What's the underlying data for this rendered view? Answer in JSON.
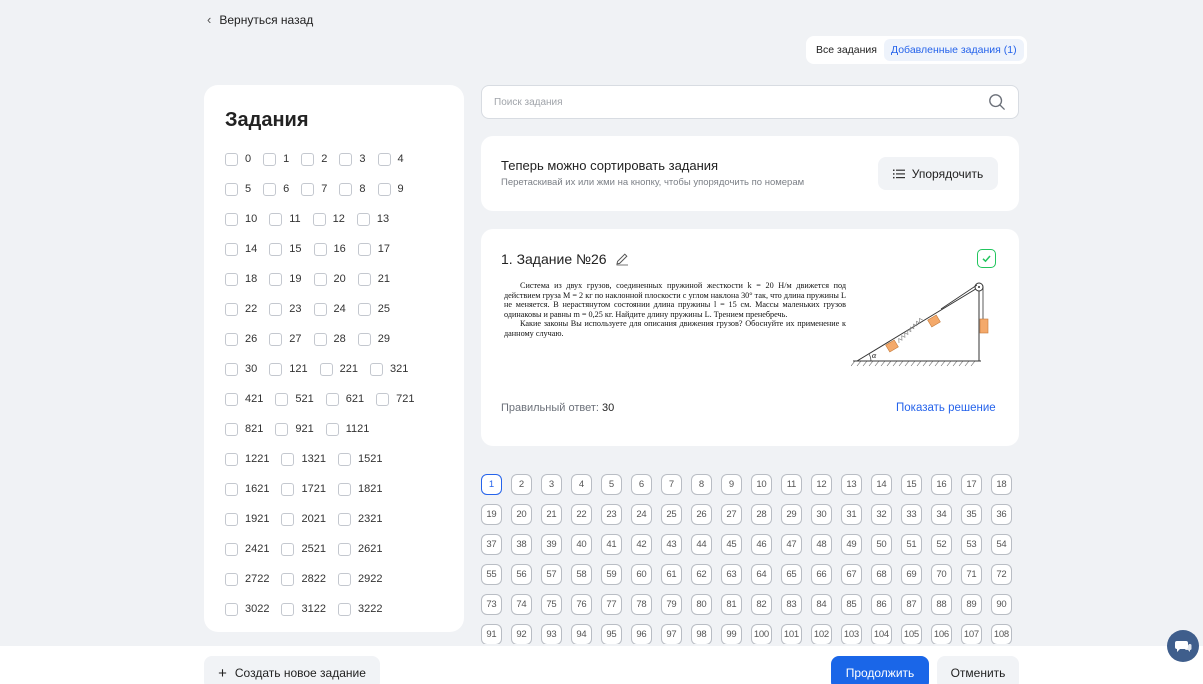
{
  "nav": {
    "back_label": "Вернуться назад"
  },
  "tabs": {
    "all": "Все задания",
    "added": "Добавленные задания (1)"
  },
  "sidebar": {
    "title": "Задания",
    "rows": [
      [
        "0",
        "1",
        "2",
        "3",
        "4"
      ],
      [
        "5",
        "6",
        "7",
        "8",
        "9"
      ],
      [
        "10",
        "11",
        "12",
        "13"
      ],
      [
        "14",
        "15",
        "16",
        "17"
      ],
      [
        "18",
        "19",
        "20",
        "21"
      ],
      [
        "22",
        "23",
        "24",
        "25"
      ],
      [
        "26",
        "27",
        "28",
        "29"
      ],
      [
        "30",
        "121",
        "221",
        "321"
      ],
      [
        "421",
        "521",
        "621",
        "721"
      ],
      [
        "821",
        "921",
        "1121"
      ],
      [
        "1221",
        "1321",
        "1521"
      ],
      [
        "1621",
        "1721",
        "1821"
      ],
      [
        "1921",
        "2021",
        "2321"
      ],
      [
        "2421",
        "2521",
        "2621"
      ],
      [
        "2722",
        "2822",
        "2922"
      ],
      [
        "3022",
        "3122",
        "3222"
      ]
    ]
  },
  "search": {
    "placeholder": "Поиск задания"
  },
  "sort": {
    "title": "Теперь можно сортировать задания",
    "subtitle": "Перетаскивай их или жми на кнопку, чтобы упорядочить по номерам",
    "button_label": "Упорядочить"
  },
  "task": {
    "title": "1. Задание №26",
    "text_p1": "Система из двух грузов, соединенных пружиной жесткости k = 20 Н/м движется под действием груза M = 2 кг по наклонной плоскости с углом наклона 30° так, что длина пружины L не меняется. В нерастянутом состоянии длина пружины l = 15 см. Массы маленьких грузов одинаковы и равны m = 0,25 кг. Найдите длину пружины L. Трением пренебречь.",
    "text_p2": "Какие законы Вы используете для описания движения грузов? Обоснуйте их применение к данному случаю.",
    "figure_label": "α",
    "answer_label": "Правильный ответ:",
    "answer_value": "30",
    "show_solution": "Показать решение",
    "checked": true
  },
  "pager": {
    "active": "1",
    "rows": [
      [
        "1",
        "2",
        "3",
        "4",
        "5",
        "6",
        "7",
        "8",
        "9",
        "10",
        "11",
        "12",
        "13",
        "14",
        "15",
        "16",
        "17",
        "18"
      ],
      [
        "19",
        "20",
        "21",
        "22",
        "23",
        "24",
        "25",
        "26",
        "27",
        "28",
        "29",
        "30",
        "31",
        "32",
        "33",
        "34",
        "35",
        "36"
      ],
      [
        "37",
        "38",
        "39",
        "40",
        "41",
        "42",
        "43",
        "44",
        "45",
        "46",
        "47",
        "48",
        "49",
        "50",
        "51",
        "52",
        "53",
        "54"
      ],
      [
        "55",
        "56",
        "57",
        "58",
        "59",
        "60",
        "61",
        "62",
        "63",
        "64",
        "65",
        "66",
        "67",
        "68",
        "69",
        "70",
        "71",
        "72"
      ],
      [
        "73",
        "74",
        "75",
        "76",
        "77",
        "78",
        "79",
        "80",
        "81",
        "82",
        "83",
        "84",
        "85",
        "86",
        "87",
        "88",
        "89",
        "90"
      ],
      [
        "91",
        "92",
        "93",
        "94",
        "95",
        "96",
        "97",
        "98",
        "99",
        "100",
        "101",
        "102",
        "103",
        "104",
        "105",
        "106",
        "107",
        "108"
      ]
    ]
  },
  "footer": {
    "create_label": "Создать новое задание",
    "continue_label": "Продолжить",
    "cancel_label": "Отменить"
  },
  "colors": {
    "accent": "#1a66e8",
    "success": "#22c55e",
    "background": "#f0f2f5"
  }
}
